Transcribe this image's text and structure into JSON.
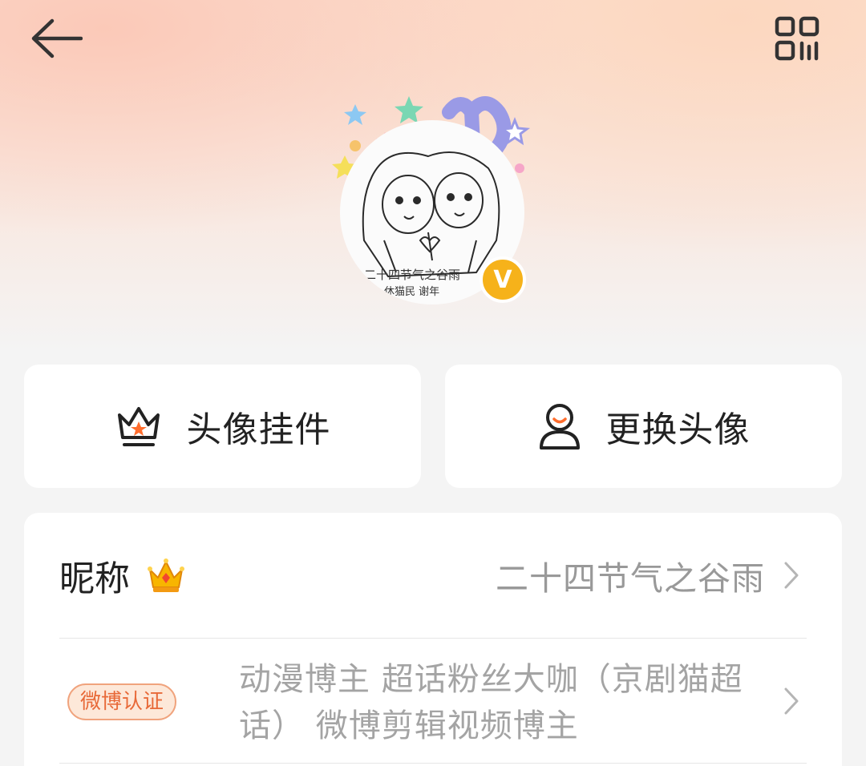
{
  "colors": {
    "accent": "#ff6d2d",
    "verified": "#f6b21a",
    "cert_badge_text": "#e86a39",
    "muted_text": "#999999"
  },
  "header": {
    "back_icon": "arrow-left-icon",
    "qr_icon": "qr-code-icon"
  },
  "avatar": {
    "caption_line1": "二十四节气之谷雨",
    "caption_line2": "休猫民 谢年",
    "verified_mark": "V"
  },
  "actions": {
    "pendant": {
      "icon": "crown-outline-icon",
      "label": "头像挂件"
    },
    "change": {
      "icon": "person-icon",
      "label": "更换头像"
    }
  },
  "profile": {
    "nickname": {
      "label": "昵称",
      "icon": "vip-crown-icon",
      "value": "二十四节气之谷雨"
    },
    "certification": {
      "badge": "微博认证",
      "text": "动漫博主 超话粉丝大咖（京剧猫超话） 微博剪辑视频博主"
    }
  }
}
